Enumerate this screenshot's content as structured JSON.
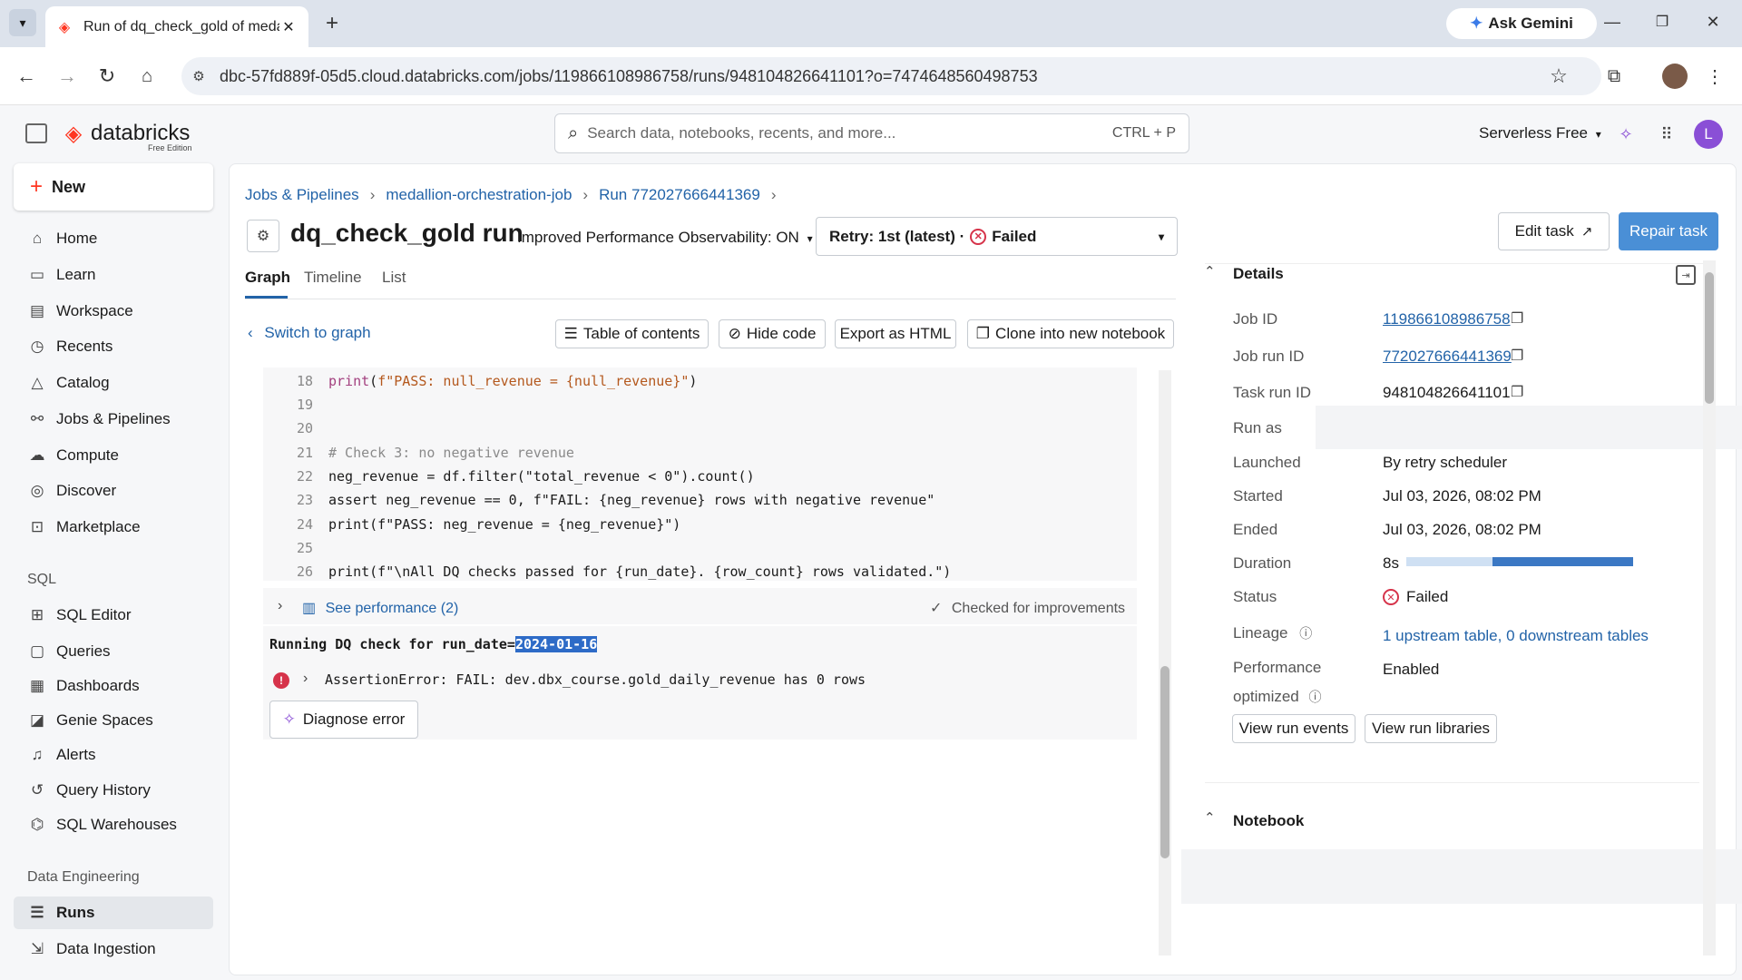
{
  "browser": {
    "tab_title": "Run of dq_check_gold of meda",
    "url": "dbc-57fd889f-05d5.cloud.databricks.com/jobs/119866108986758/runs/948104826641101?o=7474648560498753",
    "gemini_label": "Ask Gemini",
    "profile_initial": "L"
  },
  "header": {
    "brand": "databricks",
    "brand_sub": "Free Edition",
    "search_placeholder": "Search data, notebooks, recents, and more...",
    "search_shortcut": "CTRL + P",
    "workspace": "Serverless Free",
    "avatar": "L"
  },
  "sidebar": {
    "new_label": "New",
    "items": [
      {
        "label": "Home",
        "icon": "home-icon"
      },
      {
        "label": "Learn",
        "icon": "learn-icon"
      },
      {
        "label": "Workspace",
        "icon": "workspace-icon"
      },
      {
        "label": "Recents",
        "icon": "clock-icon"
      },
      {
        "label": "Catalog",
        "icon": "catalog-icon"
      },
      {
        "label": "Jobs & Pipelines",
        "icon": "jobs-icon"
      },
      {
        "label": "Compute",
        "icon": "cloud-icon"
      },
      {
        "label": "Discover",
        "icon": "compass-icon"
      },
      {
        "label": "Marketplace",
        "icon": "store-icon"
      }
    ],
    "sql_section": "SQL",
    "sql_items": [
      {
        "label": "SQL Editor",
        "icon": "editor-icon"
      },
      {
        "label": "Queries",
        "icon": "query-icon"
      },
      {
        "label": "Dashboards",
        "icon": "dashboard-icon"
      },
      {
        "label": "Genie Spaces",
        "icon": "genie-icon"
      },
      {
        "label": "Alerts",
        "icon": "bell-icon"
      },
      {
        "label": "Query History",
        "icon": "history-icon"
      },
      {
        "label": "SQL Warehouses",
        "icon": "warehouse-icon"
      }
    ],
    "de_section": "Data Engineering",
    "de_items": [
      {
        "label": "Runs",
        "icon": "runs-icon",
        "active": true
      },
      {
        "label": "Data Ingestion",
        "icon": "ingest-icon"
      }
    ]
  },
  "breadcrumb": [
    "Jobs & Pipelines",
    "medallion-orchestration-job",
    "Run 772027666441369"
  ],
  "run": {
    "title": "dq_check_gold run",
    "perf_toggle": "Improved Performance Observability: ON",
    "retry_label": "Retry: 1st (latest) ·",
    "retry_status": "Failed",
    "edit_task": "Edit task",
    "repair_task": "Repair task"
  },
  "tabs": [
    "Graph",
    "Timeline",
    "List"
  ],
  "toolbar": {
    "switch_graph": "Switch to graph",
    "toc": "Table of contents",
    "hide_code": "Hide code",
    "export": "Export as HTML",
    "clone": "Clone into new notebook"
  },
  "code_lines": [
    {
      "n": "18",
      "text": "print(f\"PASS: null_revenue = {null_revenue}\")"
    },
    {
      "n": "19",
      "text": ""
    },
    {
      "n": "20",
      "text": ""
    },
    {
      "n": "21",
      "text": "# Check 3: no negative revenue"
    },
    {
      "n": "22",
      "text": "neg_revenue = df.filter(\"total_revenue < 0\").count()"
    },
    {
      "n": "23",
      "text": "assert neg_revenue == 0, f\"FAIL: {neg_revenue} rows with negative revenue\""
    },
    {
      "n": "24",
      "text": "print(f\"PASS: neg_revenue = {neg_revenue}\")"
    },
    {
      "n": "25",
      "text": ""
    },
    {
      "n": "26",
      "text": "print(f\"\\nAll DQ checks passed for {run_date}. {row_count} rows validated.\")"
    }
  ],
  "perf": {
    "see_performance": "See performance (2)",
    "checked": "Checked for improvements"
  },
  "output": {
    "running_prefix": "Running DQ check for run_date=",
    "running_date": "2024-01-16",
    "error": "AssertionError: FAIL: dev.dbx_course.gold_daily_revenue has 0 rows",
    "diagnose": "Diagnose error"
  },
  "details": {
    "title": "Details",
    "job_id_label": "Job ID",
    "job_id": "119866108986758",
    "job_run_id_label": "Job run ID",
    "job_run_id": "772027666441369",
    "task_run_id_label": "Task run ID",
    "task_run_id": "948104826641101",
    "run_as_label": "Run as",
    "launched_label": "Launched",
    "launched": "By retry scheduler",
    "started_label": "Started",
    "started": "Jul 03, 2026, 08:02 PM",
    "ended_label": "Ended",
    "ended": "Jul 03, 2026, 08:02 PM",
    "duration_label": "Duration",
    "duration": "8s",
    "duration_fill_fraction": 0.38,
    "status_label": "Status",
    "status": "Failed",
    "lineage_label": "Lineage",
    "lineage": "1 upstream table, 0 downstream tables",
    "perf_label_1": "Performance",
    "perf_label_2": "optimized",
    "perf_value": "Enabled",
    "view_events": "View run events",
    "view_libraries": "View run libraries",
    "notebook_title": "Notebook"
  },
  "colors": {
    "brand": "#ff3621",
    "link": "#2263a8",
    "primary_button": "#4a8fd6",
    "error": "#d6334a"
  }
}
